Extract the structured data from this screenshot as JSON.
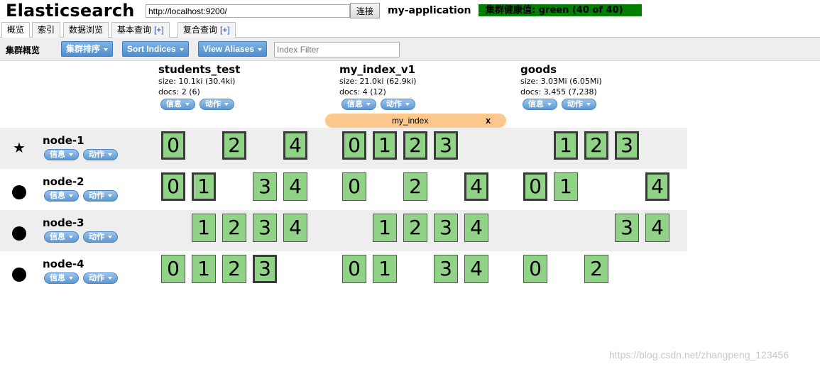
{
  "header": {
    "title": "Elasticsearch",
    "url_value": "http://localhost:9200/",
    "connect_label": "连接",
    "cluster_name": "my-application",
    "health_text": "集群健康值: green (40 of 40)",
    "health_color": "#008000"
  },
  "tabs": [
    {
      "label": "概览",
      "plus": ""
    },
    {
      "label": "索引",
      "plus": ""
    },
    {
      "label": "数据浏览",
      "plus": ""
    },
    {
      "label": "基本查询",
      "plus": "[+]"
    },
    {
      "label": "复合查询",
      "plus": "[+]"
    }
  ],
  "toolbar": {
    "label": "集群概览",
    "sort_cluster_label": "集群排序",
    "sort_indices_label": "Sort Indices",
    "view_aliases_label": "View Aliases",
    "index_filter_placeholder": "Index Filter"
  },
  "pill_labels": {
    "info": "信息",
    "action": "动作"
  },
  "indices": [
    {
      "name": "students_test",
      "size": "size: 10.1ki (30.4ki)",
      "docs": "docs: 2 (6)"
    },
    {
      "name": "my_index_v1",
      "size": "size: 21.0ki (62.9ki)",
      "docs": "docs: 4 (12)"
    },
    {
      "name": "goods",
      "size": "size: 3.03Mi (6.05Mi)",
      "docs": "docs: 3,455 (7,238)"
    }
  ],
  "alias": {
    "name": "my_index",
    "close": "x"
  },
  "nodes": [
    {
      "name": "node-1",
      "icon": "star-icon",
      "symbol": "★"
    },
    {
      "name": "node-2",
      "icon": "circle-icon",
      "symbol": ""
    },
    {
      "name": "node-3",
      "icon": "circle-icon",
      "symbol": ""
    },
    {
      "name": "node-4",
      "icon": "circle-icon",
      "symbol": ""
    }
  ],
  "shards": [
    [
      [
        {
          "n": "0",
          "primary": true
        },
        null,
        {
          "n": "2",
          "primary": true
        },
        null,
        {
          "n": "4",
          "primary": true
        }
      ],
      [
        {
          "n": "0",
          "primary": true
        },
        {
          "n": "1",
          "primary": true
        },
        {
          "n": "2",
          "primary": true
        },
        {
          "n": "3",
          "primary": true
        },
        null
      ],
      [
        null,
        {
          "n": "1",
          "primary": true
        },
        {
          "n": "2",
          "primary": true
        },
        {
          "n": "3",
          "primary": true
        },
        null
      ]
    ],
    [
      [
        {
          "n": "0",
          "primary": true
        },
        {
          "n": "1",
          "primary": true
        },
        null,
        {
          "n": "3",
          "primary": false
        },
        {
          "n": "4",
          "primary": false
        }
      ],
      [
        {
          "n": "0",
          "primary": false
        },
        null,
        {
          "n": "2",
          "primary": false
        },
        null,
        {
          "n": "4",
          "primary": true
        }
      ],
      [
        {
          "n": "0",
          "primary": true
        },
        {
          "n": "1",
          "primary": false
        },
        null,
        null,
        {
          "n": "4",
          "primary": true
        }
      ]
    ],
    [
      [
        null,
        {
          "n": "1",
          "primary": false
        },
        {
          "n": "2",
          "primary": false
        },
        {
          "n": "3",
          "primary": false
        },
        {
          "n": "4",
          "primary": false
        }
      ],
      [
        null,
        {
          "n": "1",
          "primary": false
        },
        {
          "n": "2",
          "primary": false
        },
        {
          "n": "3",
          "primary": false
        },
        {
          "n": "4",
          "primary": false
        }
      ],
      [
        null,
        null,
        null,
        {
          "n": "3",
          "primary": false
        },
        {
          "n": "4",
          "primary": false
        }
      ]
    ],
    [
      [
        {
          "n": "0",
          "primary": false
        },
        {
          "n": "1",
          "primary": false
        },
        {
          "n": "2",
          "primary": false
        },
        {
          "n": "3",
          "primary": true
        },
        null
      ],
      [
        {
          "n": "0",
          "primary": false
        },
        {
          "n": "1",
          "primary": false
        },
        null,
        {
          "n": "3",
          "primary": false
        },
        {
          "n": "4",
          "primary": false
        }
      ],
      [
        {
          "n": "0",
          "primary": false
        },
        null,
        {
          "n": "2",
          "primary": false
        },
        null,
        null
      ]
    ]
  ],
  "watermark": "https://blog.csdn.net/zhangpeng_123456"
}
